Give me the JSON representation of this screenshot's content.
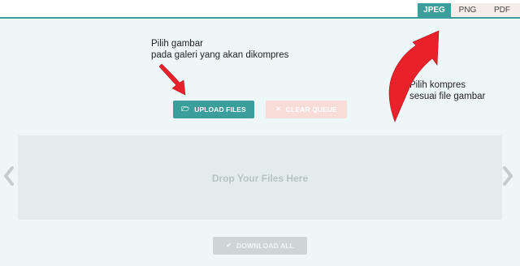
{
  "tabs": [
    {
      "label": "JPEG",
      "active": true
    },
    {
      "label": "PNG",
      "active": false
    },
    {
      "label": "PDF",
      "active": false
    }
  ],
  "annotations": {
    "left_line1": "Pilih gambar",
    "left_line2": "pada galeri yang akan dikompres",
    "right_line1": "Pilih kompres",
    "right_line2": "sesuai file gambar"
  },
  "buttons": {
    "upload": "UPLOAD FILES",
    "clear": "CLEAR QUEUE",
    "download": "DOWNLOAD ALL"
  },
  "dropzone": {
    "text": "Drop Your Files Here"
  },
  "icons": {
    "upload": "folder-open-icon",
    "clear": "close-icon",
    "download": "check-icon",
    "prev": "chevron-left-icon",
    "next": "chevron-right-icon"
  },
  "colors": {
    "accent": "#3a9e9b",
    "arrow": "#e8212b",
    "background": "#eef7f8"
  }
}
